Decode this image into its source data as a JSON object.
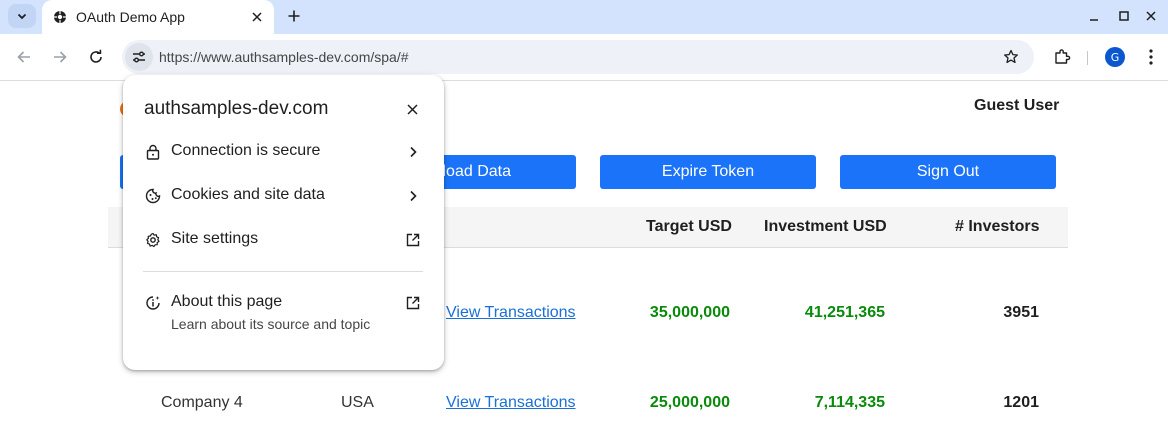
{
  "browser": {
    "tab_title": "OAuth Demo App",
    "url": "https://www.authsamples-dev.com/spa/#",
    "profile_initial": "G",
    "accent": "#d3e3fd"
  },
  "page": {
    "user_name": "Guest User",
    "buttons": {
      "load_data": "load Data",
      "expire_token": "Expire Token",
      "sign_out": "Sign Out"
    },
    "table": {
      "headers": [
        "Target USD",
        "Investment USD",
        "# Investors"
      ],
      "rows": [
        {
          "name": "",
          "country": "",
          "link": "View Transactions",
          "target": "35,000,000",
          "investment": "41,251,365",
          "investors": "3951"
        },
        {
          "name": "Company 4",
          "country": "USA",
          "link": "View Transactions",
          "target": "25,000,000",
          "investment": "7,114,335",
          "investors": "1201"
        }
      ]
    },
    "colors": {
      "button": "#1a73f8",
      "money": "#0a8a0a",
      "link": "#1a6fd8"
    }
  },
  "popup": {
    "domain": "authsamples-dev.com",
    "items": [
      {
        "label": "Connection is secure",
        "icon": "lock-icon",
        "trail": "chevron-right-icon"
      },
      {
        "label": "Cookies and site data",
        "icon": "cookie-icon",
        "trail": "chevron-right-icon"
      },
      {
        "label": "Site settings",
        "icon": "gear-icon",
        "trail": "open-in-new-icon"
      }
    ],
    "about": {
      "title": "About this page",
      "subtitle": "Learn about its source and topic"
    }
  }
}
